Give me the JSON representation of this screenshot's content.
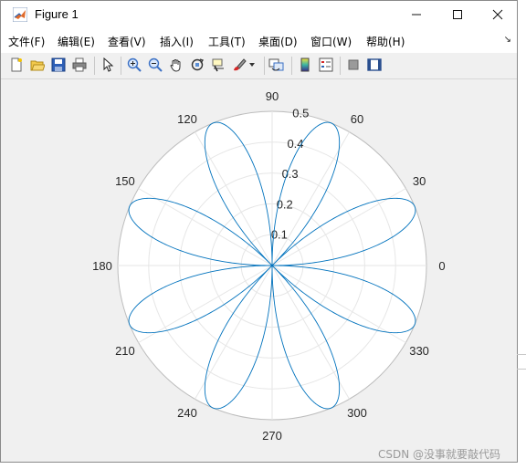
{
  "window": {
    "title": "Figure 1"
  },
  "controls": {
    "minimize": "—",
    "maximize": "☐",
    "close": "✕"
  },
  "menu": [
    {
      "label": "文件(F)"
    },
    {
      "label": "编辑(E)"
    },
    {
      "label": "查看(V)"
    },
    {
      "label": "插入(I)"
    },
    {
      "label": "工具(T)"
    },
    {
      "label": "桌面(D)"
    },
    {
      "label": "窗口(W)"
    },
    {
      "label": "帮助(H)"
    }
  ],
  "toolbar_icons": [
    "new-figure-icon",
    "open-file-icon",
    "save-icon",
    "print-icon",
    "pointer-icon",
    "zoom-in-icon",
    "zoom-out-icon",
    "pan-icon",
    "rotate-icon",
    "data-cursor-icon",
    "brush-icon",
    "link-plot-icon",
    "colorbar-icon",
    "legend-icon",
    "hide-plot-tools-icon",
    "show-plot-tools-icon"
  ],
  "watermark": "CSDN @没事就要敲代码",
  "chart_data": {
    "type": "line",
    "coordinate_system": "polar",
    "equation_shape": "8-petal rose, r = 0.5·|sin(4θ)|",
    "theta_ticks": [
      "0",
      "30",
      "60",
      "90",
      "120",
      "150",
      "180",
      "210",
      "240",
      "270",
      "300",
      "330"
    ],
    "r_ticks": [
      "0.1",
      "0.2",
      "0.3",
      "0.4",
      "0.5"
    ],
    "rlim": [
      0,
      0.5
    ],
    "petals": 8,
    "max_r": 0.5,
    "grid": true,
    "series_color": "#0072BD"
  }
}
